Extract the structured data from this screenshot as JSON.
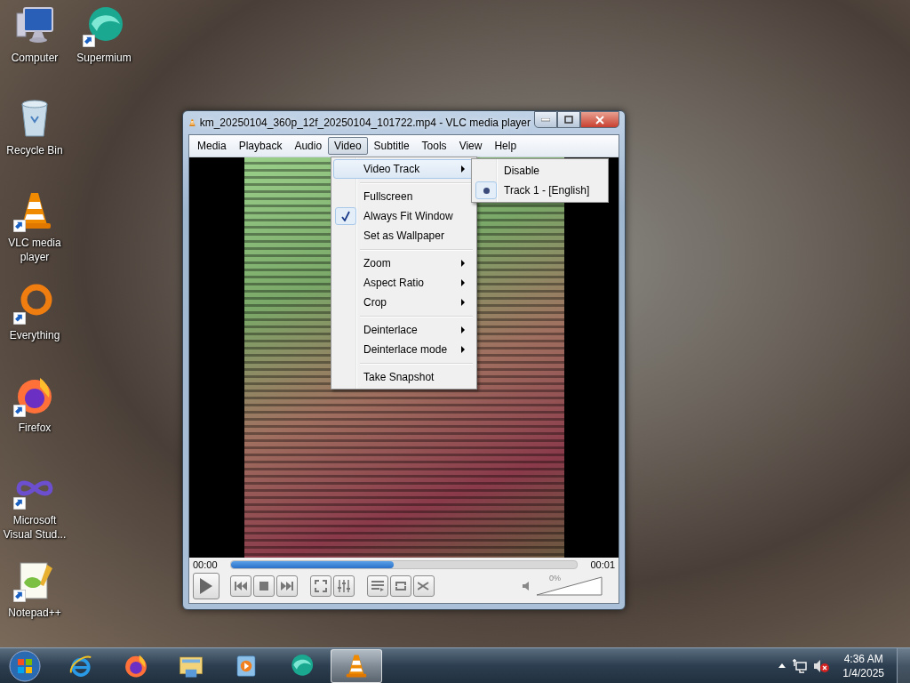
{
  "desktop_icons": [
    {
      "label": "Computer",
      "kind": "computer",
      "shortcut": false
    },
    {
      "label": "Recycle Bin",
      "kind": "recycle",
      "shortcut": false
    },
    {
      "label": "VLC media player",
      "kind": "vlc",
      "shortcut": true
    },
    {
      "label": "Everything",
      "kind": "everything",
      "shortcut": true
    },
    {
      "label": "Firefox",
      "kind": "firefox",
      "shortcut": true
    },
    {
      "label": "Microsoft Visual Stud...",
      "kind": "visualstudio",
      "shortcut": true
    },
    {
      "label": "Notepad++",
      "kind": "notepad",
      "shortcut": true
    },
    {
      "label": "Supermium",
      "kind": "supermium",
      "shortcut": true
    }
  ],
  "window": {
    "title": "km_20250104_360p_12f_20250104_101722.mp4 - VLC media player",
    "menu": [
      {
        "label": "Media",
        "selected": false
      },
      {
        "label": "Playback",
        "selected": false
      },
      {
        "label": "Audio",
        "selected": false
      },
      {
        "label": "Video",
        "selected": true
      },
      {
        "label": "Subtitle",
        "selected": false
      },
      {
        "label": "Tools",
        "selected": false
      },
      {
        "label": "View",
        "selected": false
      },
      {
        "label": "Help",
        "selected": false
      }
    ],
    "time_elapsed": "00:00",
    "time_total": "00:01",
    "progress": {
      "level": 0.47
    },
    "volume": {
      "reading": "0%",
      "level": 0
    }
  },
  "video_menu": {
    "groups": [
      [
        {
          "label": "Video Track",
          "submenu": true,
          "checked": false,
          "selected": true
        }
      ],
      [
        {
          "label": "Fullscreen",
          "submenu": false,
          "checked": false,
          "selected": false
        },
        {
          "label": "Always Fit Window",
          "submenu": false,
          "checked": true,
          "selected": false
        },
        {
          "label": "Set as Wallpaper",
          "submenu": false,
          "checked": false,
          "selected": false
        }
      ],
      [
        {
          "label": "Zoom",
          "submenu": true,
          "checked": false,
          "selected": false
        },
        {
          "label": "Aspect Ratio",
          "submenu": true,
          "checked": false,
          "selected": false
        },
        {
          "label": "Crop",
          "submenu": true,
          "checked": false,
          "selected": false
        }
      ],
      [
        {
          "label": "Deinterlace",
          "submenu": true,
          "checked": false,
          "selected": false
        },
        {
          "label": "Deinterlace mode",
          "submenu": true,
          "checked": false,
          "selected": false
        }
      ],
      [
        {
          "label": "Take Snapshot",
          "submenu": false,
          "checked": false,
          "selected": false
        }
      ]
    ]
  },
  "video_track_submenu": {
    "items": [
      {
        "label": "Disable",
        "selected": false
      },
      {
        "label": "Track 1 - [English]",
        "selected": true
      }
    ]
  },
  "taskbar": {
    "apps": [
      {
        "kind": "ie",
        "active": false
      },
      {
        "kind": "firefox",
        "active": false
      },
      {
        "kind": "explorer",
        "active": false
      },
      {
        "kind": "mediaplayer",
        "active": false
      },
      {
        "kind": "supermium",
        "active": false
      },
      {
        "kind": "vlc",
        "active": true
      }
    ],
    "clock": {
      "time": "4:36 AM",
      "date": "1/4/2025"
    }
  }
}
